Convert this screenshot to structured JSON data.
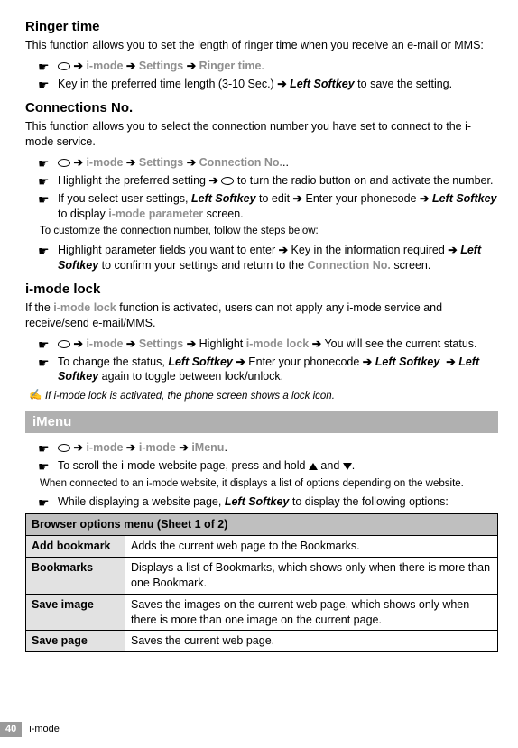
{
  "ringer": {
    "heading": "Ringer time",
    "intro": "This function allows you to set the length of ringer time when you receive an e-mail or MMS:",
    "path_imode": "i-mode",
    "path_settings": "Settings",
    "path_ringer": "Ringer time",
    "l2_a": "Key in the preferred time length (3-10 Sec.) ",
    "l2_b": "Left Softkey",
    "l2_c": " to save the setting."
  },
  "conn": {
    "heading": "Connections No.",
    "intro": "This function allows you to select the connection number you have set to connect to the i-mode service.",
    "path_imode": "i-mode",
    "path_settings": "Settings",
    "path_cn": "Connection No.",
    "l2_a": "Highlight the preferred setting ",
    "l2_b": " to turn the radio button on and activate the number.",
    "l3_a": "If you select user settings, ",
    "l3_ls": "Left Softkey",
    "l3_b": " to edit ",
    "l3_c": " Enter your phonecode ",
    "l3_d": " to display ",
    "l3_param": "i-mode parameter",
    "l3_e": " screen.",
    "customize": "To customize the connection number, follow the steps below:",
    "l4_a": "Highlight parameter fields you want to enter ",
    "l4_b": " Key in the information required ",
    "l4_c": " to confirm your settings and return to the ",
    "l4_cn": "Connection No.",
    "l4_d": " screen."
  },
  "lock": {
    "heading": "i-mode lock",
    "intro_a": "If the ",
    "intro_b": "i-mode lock",
    "intro_c": " function is activated, users can not apply any i-mode service and receive/send e-mail/MMS.",
    "l1_imode": "i-mode",
    "l1_settings": "Settings",
    "l1_hl": " Highlight ",
    "l1_lock": "i-mode lock",
    "l1_end": " You will see the current status.",
    "l2_a": "To change the status, ",
    "l2_ls": "Left Softkey",
    "l2_b": " Enter your phonecode ",
    "l2_c": " again to toggle between lock/unlock.",
    "hint": "If i-mode lock is activated, the phone screen shows a lock icon."
  },
  "imenu": {
    "banner": "iMenu",
    "p_imode": "i-mode",
    "p_imode2": "i-mode",
    "p_imenu": "iMenu",
    "scroll_a": "To scroll the i-mode website page, press and hold ",
    "scroll_b": " and ",
    "scroll_c": ".",
    "note": "When connected to an i-mode website, it displays a list of options depending on the website.",
    "l3_a": "While displaying a website page, ",
    "l3_ls": "Left Softkey",
    "l3_b": " to display the following options:"
  },
  "table": {
    "header": "Browser options menu (Sheet 1 of 2)",
    "rows": [
      {
        "h": "Add bookmark",
        "d": "Adds the current web page to the Bookmarks."
      },
      {
        "h": "Bookmarks",
        "d": "Displays a list of Bookmarks, which shows only when there is more than one Bookmark."
      },
      {
        "h": "Save image",
        "d": "Saves the images on the current web page, which shows only when there is more than one image on the current page."
      },
      {
        "h": "Save page",
        "d": "Saves the current web page."
      }
    ]
  },
  "arrow": "➔",
  "footer": {
    "page": "40",
    "text": "i-mode"
  }
}
